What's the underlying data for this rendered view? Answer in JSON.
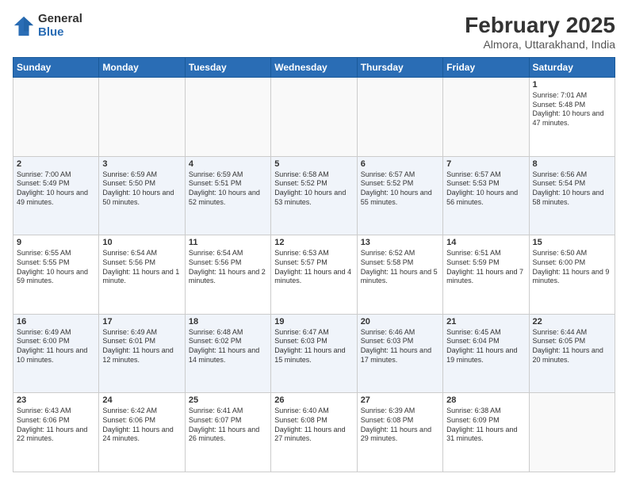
{
  "logo": {
    "general": "General",
    "blue": "Blue"
  },
  "title": "February 2025",
  "subtitle": "Almora, Uttarakhand, India",
  "days_of_week": [
    "Sunday",
    "Monday",
    "Tuesday",
    "Wednesday",
    "Thursday",
    "Friday",
    "Saturday"
  ],
  "weeks": [
    [
      {
        "day": "",
        "info": ""
      },
      {
        "day": "",
        "info": ""
      },
      {
        "day": "",
        "info": ""
      },
      {
        "day": "",
        "info": ""
      },
      {
        "day": "",
        "info": ""
      },
      {
        "day": "",
        "info": ""
      },
      {
        "day": "1",
        "info": "Sunrise: 7:01 AM\nSunset: 5:48 PM\nDaylight: 10 hours and 47 minutes."
      }
    ],
    [
      {
        "day": "2",
        "info": "Sunrise: 7:00 AM\nSunset: 5:49 PM\nDaylight: 10 hours and 49 minutes."
      },
      {
        "day": "3",
        "info": "Sunrise: 6:59 AM\nSunset: 5:50 PM\nDaylight: 10 hours and 50 minutes."
      },
      {
        "day": "4",
        "info": "Sunrise: 6:59 AM\nSunset: 5:51 PM\nDaylight: 10 hours and 52 minutes."
      },
      {
        "day": "5",
        "info": "Sunrise: 6:58 AM\nSunset: 5:52 PM\nDaylight: 10 hours and 53 minutes."
      },
      {
        "day": "6",
        "info": "Sunrise: 6:57 AM\nSunset: 5:52 PM\nDaylight: 10 hours and 55 minutes."
      },
      {
        "day": "7",
        "info": "Sunrise: 6:57 AM\nSunset: 5:53 PM\nDaylight: 10 hours and 56 minutes."
      },
      {
        "day": "8",
        "info": "Sunrise: 6:56 AM\nSunset: 5:54 PM\nDaylight: 10 hours and 58 minutes."
      }
    ],
    [
      {
        "day": "9",
        "info": "Sunrise: 6:55 AM\nSunset: 5:55 PM\nDaylight: 10 hours and 59 minutes."
      },
      {
        "day": "10",
        "info": "Sunrise: 6:54 AM\nSunset: 5:56 PM\nDaylight: 11 hours and 1 minute."
      },
      {
        "day": "11",
        "info": "Sunrise: 6:54 AM\nSunset: 5:56 PM\nDaylight: 11 hours and 2 minutes."
      },
      {
        "day": "12",
        "info": "Sunrise: 6:53 AM\nSunset: 5:57 PM\nDaylight: 11 hours and 4 minutes."
      },
      {
        "day": "13",
        "info": "Sunrise: 6:52 AM\nSunset: 5:58 PM\nDaylight: 11 hours and 5 minutes."
      },
      {
        "day": "14",
        "info": "Sunrise: 6:51 AM\nSunset: 5:59 PM\nDaylight: 11 hours and 7 minutes."
      },
      {
        "day": "15",
        "info": "Sunrise: 6:50 AM\nSunset: 6:00 PM\nDaylight: 11 hours and 9 minutes."
      }
    ],
    [
      {
        "day": "16",
        "info": "Sunrise: 6:49 AM\nSunset: 6:00 PM\nDaylight: 11 hours and 10 minutes."
      },
      {
        "day": "17",
        "info": "Sunrise: 6:49 AM\nSunset: 6:01 PM\nDaylight: 11 hours and 12 minutes."
      },
      {
        "day": "18",
        "info": "Sunrise: 6:48 AM\nSunset: 6:02 PM\nDaylight: 11 hours and 14 minutes."
      },
      {
        "day": "19",
        "info": "Sunrise: 6:47 AM\nSunset: 6:03 PM\nDaylight: 11 hours and 15 minutes."
      },
      {
        "day": "20",
        "info": "Sunrise: 6:46 AM\nSunset: 6:03 PM\nDaylight: 11 hours and 17 minutes."
      },
      {
        "day": "21",
        "info": "Sunrise: 6:45 AM\nSunset: 6:04 PM\nDaylight: 11 hours and 19 minutes."
      },
      {
        "day": "22",
        "info": "Sunrise: 6:44 AM\nSunset: 6:05 PM\nDaylight: 11 hours and 20 minutes."
      }
    ],
    [
      {
        "day": "23",
        "info": "Sunrise: 6:43 AM\nSunset: 6:06 PM\nDaylight: 11 hours and 22 minutes."
      },
      {
        "day": "24",
        "info": "Sunrise: 6:42 AM\nSunset: 6:06 PM\nDaylight: 11 hours and 24 minutes."
      },
      {
        "day": "25",
        "info": "Sunrise: 6:41 AM\nSunset: 6:07 PM\nDaylight: 11 hours and 26 minutes."
      },
      {
        "day": "26",
        "info": "Sunrise: 6:40 AM\nSunset: 6:08 PM\nDaylight: 11 hours and 27 minutes."
      },
      {
        "day": "27",
        "info": "Sunrise: 6:39 AM\nSunset: 6:08 PM\nDaylight: 11 hours and 29 minutes."
      },
      {
        "day": "28",
        "info": "Sunrise: 6:38 AM\nSunset: 6:09 PM\nDaylight: 11 hours and 31 minutes."
      },
      {
        "day": "",
        "info": ""
      }
    ]
  ]
}
